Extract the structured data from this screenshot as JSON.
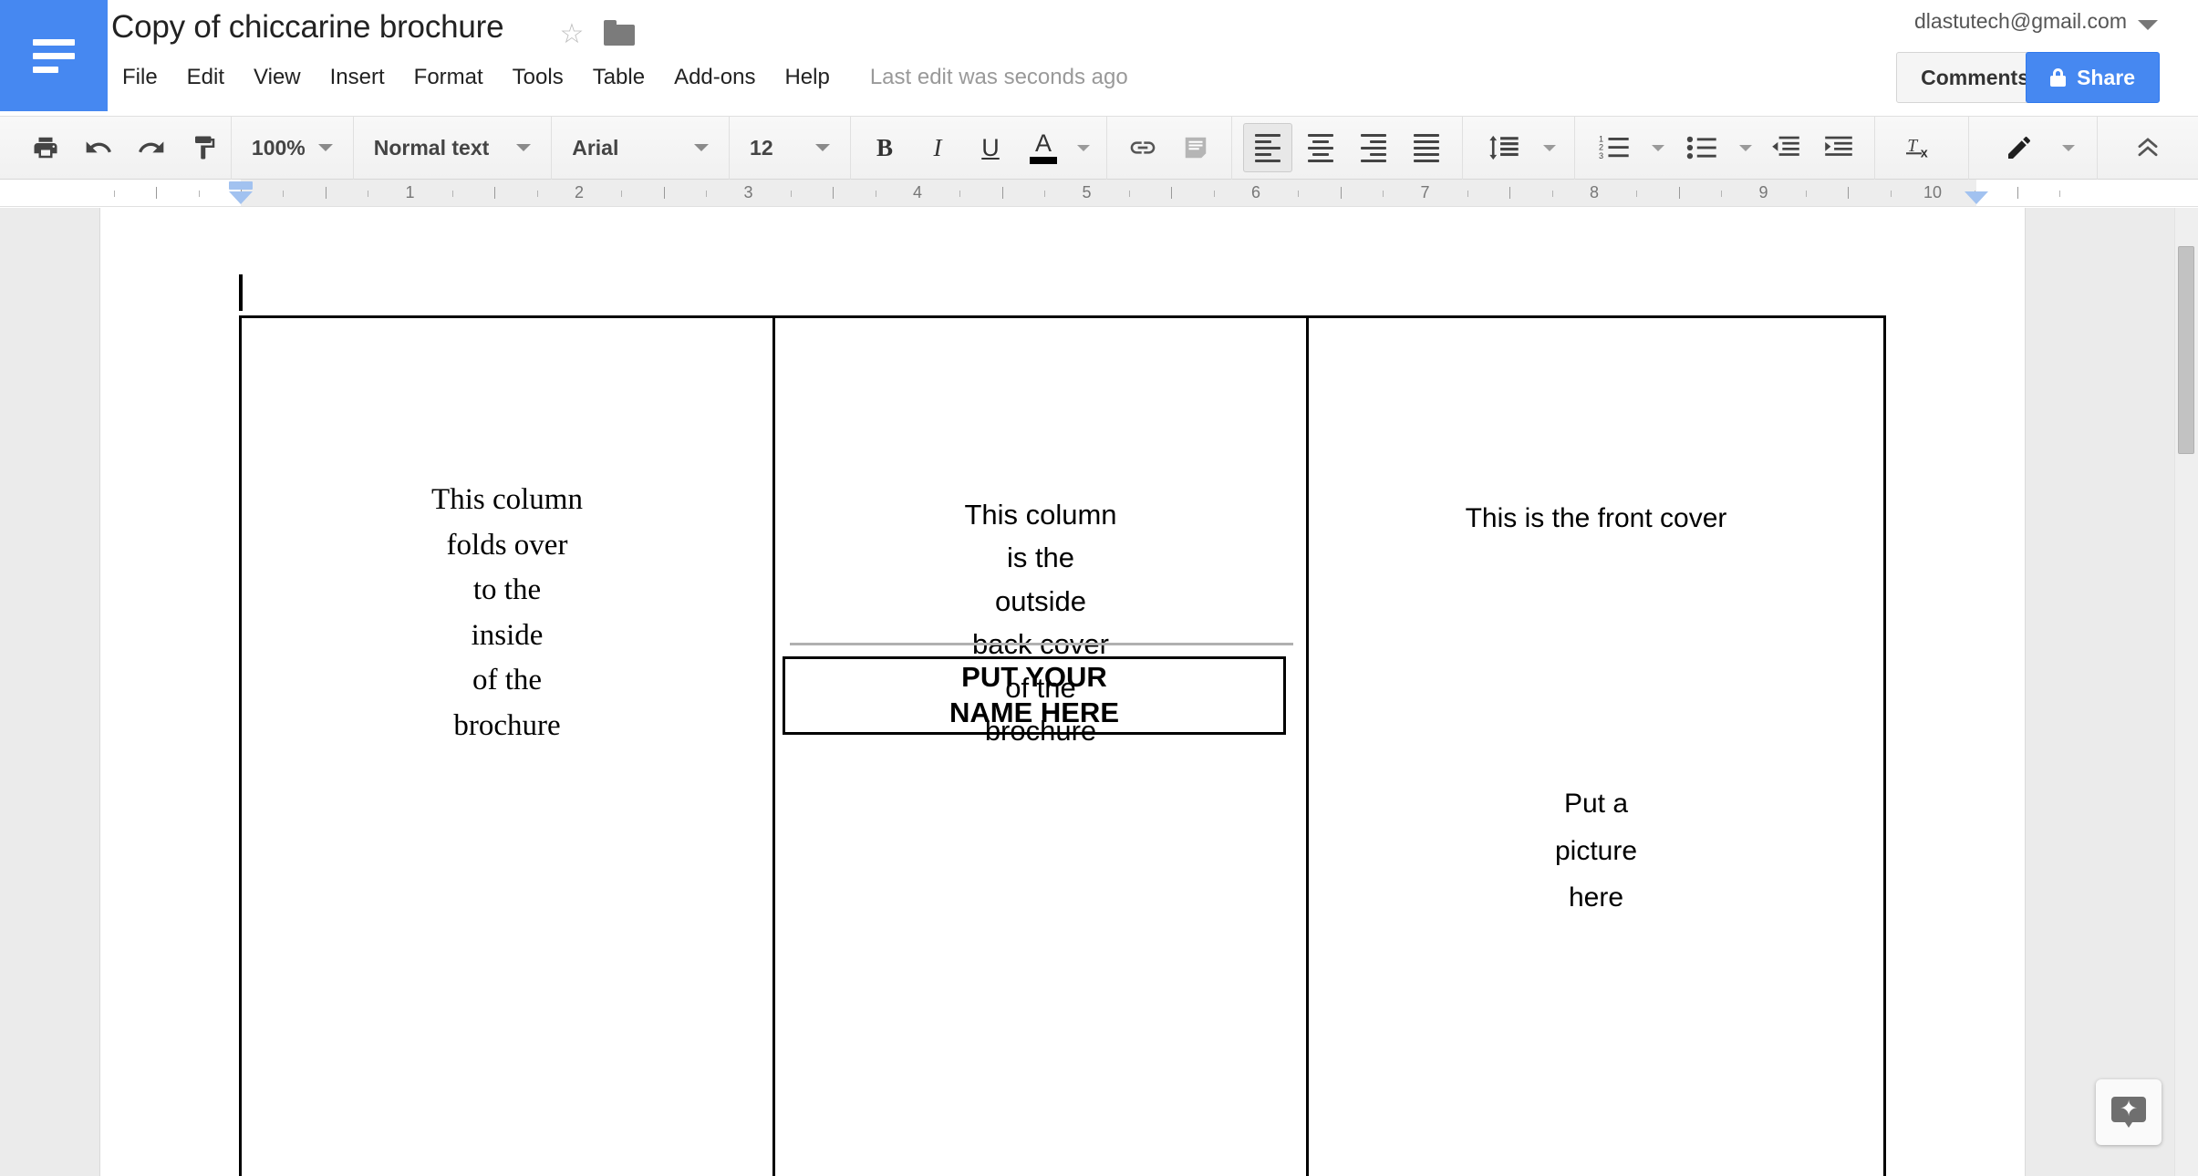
{
  "header": {
    "doc_title": "Copy of chiccarine brochure",
    "star_icon": "star-outline-icon",
    "folder_icon": "folder-icon",
    "menu_items": [
      "File",
      "Edit",
      "View",
      "Insert",
      "Format",
      "Tools",
      "Table",
      "Add-ons",
      "Help"
    ],
    "last_edit": "Last edit was seconds ago",
    "account_email": "dlastutech@gmail.com",
    "comments_label": "Comments",
    "share_label": "Share",
    "brand_color": "#4688f1"
  },
  "toolbar": {
    "print_icon": "print-icon",
    "undo_icon": "undo-icon",
    "redo_icon": "redo-icon",
    "paint_format_icon": "paint-format-icon",
    "zoom_value": "100%",
    "style_value": "Normal text",
    "font_value": "Arial",
    "font_size_value": "12",
    "bold_label": "B",
    "italic_label": "I",
    "underline_label": "U",
    "text_color_label": "A",
    "text_color_swatch": "#000000",
    "link_icon": "link-icon",
    "comment_icon": "add-comment-icon",
    "align_left_icon": "align-left-icon",
    "align_center_icon": "align-center-icon",
    "align_right_icon": "align-right-icon",
    "align_justify_icon": "align-justify-icon",
    "line_spacing_icon": "line-spacing-icon",
    "numbered_list_icon": "numbered-list-icon",
    "bulleted_list_icon": "bulleted-list-icon",
    "decrease_indent_icon": "decrease-indent-icon",
    "increase_indent_icon": "increase-indent-icon",
    "clear_formatting_icon": "clear-formatting-icon",
    "edit_mode_icon": "pencil-icon",
    "collapse_icon": "double-chevron-up-icon",
    "active_alignment": "left"
  },
  "ruler": {
    "numbers": [
      "1",
      "2",
      "3",
      "4",
      "5",
      "6",
      "7",
      "8",
      "9",
      "10"
    ],
    "left_indent_marker": "left-indent-marker",
    "right_indent_marker": "right-indent-marker"
  },
  "document": {
    "columns": [
      {
        "name": "inside-fold-column",
        "font": "serif",
        "text": "This column\nfolds over\nto the\ninside\nof the\nbrochure"
      },
      {
        "name": "outside-back-cover-column",
        "font": "sans",
        "text": "This column\nis the\noutside\nback cover\nof the\nbrochure",
        "divider": true,
        "name_box": "PUT YOUR\nNAME HERE"
      },
      {
        "name": "front-cover-column",
        "font": "sans",
        "text": "This is the front cover",
        "picture_placeholder": "Put a\npicture\nhere"
      }
    ]
  },
  "explore": {
    "icon": "explore-star-icon"
  }
}
